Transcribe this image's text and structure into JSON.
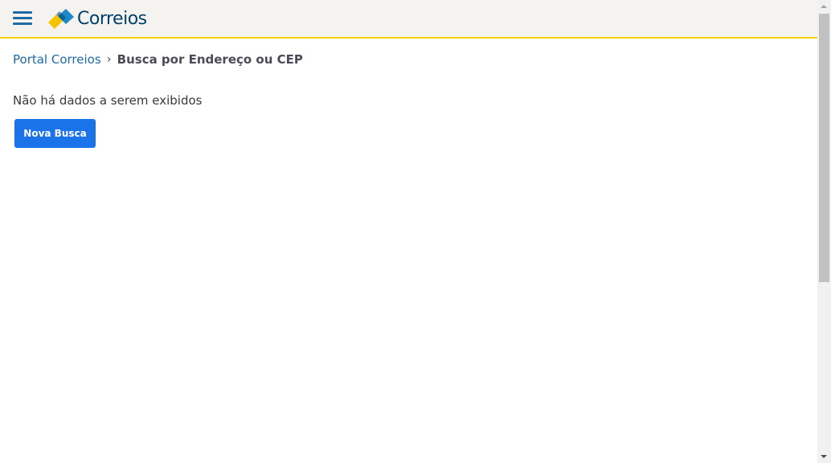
{
  "header": {
    "menu_icon": "hamburger-menu-icon",
    "logo_text": "Correios",
    "logo_colors": {
      "yellow": "#f5c400",
      "blue": "#1e88c8",
      "dark_blue": "#00416b"
    },
    "accent_border": "#f5d200"
  },
  "breadcrumb": {
    "home_label": "Portal Correios",
    "separator": "›",
    "current_label": "Busca por Endereço ou CEP"
  },
  "result": {
    "message": "Não há dados a serem exibidos",
    "new_search_label": "Nova Busca"
  },
  "theme": {
    "link_color": "#1c6aa6",
    "button_color": "#1a73e8"
  }
}
